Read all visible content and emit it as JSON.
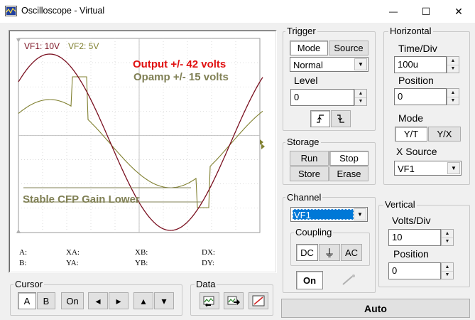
{
  "window": {
    "title": "Oscilloscope - Virtual",
    "minimize_glyph": "—",
    "maximize_glyph": "☐",
    "close_glyph": "✕"
  },
  "display": {
    "ch1_label": "VF1: 10V",
    "ch2_label": "VF2: 5V",
    "ch1_color": "#7a1020",
    "ch2_color": "#808030",
    "annotation_output": "Output +/- 42 volts",
    "annotation_opamp": "Opamp +/- 15 volts",
    "annotation_stable": "Stable CFP Gain Lower",
    "annotation_output_color": "#e01010",
    "annotation_green_color": "#808055",
    "readouts": {
      "a": "A:",
      "xa": "XA:",
      "xb": "XB:",
      "dx": "DX:",
      "b": "B:",
      "ya": "YA:",
      "yb": "YB:",
      "dy": "DY:"
    }
  },
  "trigger": {
    "title": "Trigger",
    "mode_tab": "Mode",
    "source_tab": "Source",
    "mode_value": "Normal",
    "level_label": "Level",
    "level_value": "0"
  },
  "storage": {
    "title": "Storage",
    "run": "Run",
    "stop": "Stop",
    "store": "Store",
    "erase": "Erase"
  },
  "horizontal": {
    "title": "Horizontal",
    "time_div_label": "Time/Div",
    "time_div_value": "100u",
    "position_label": "Position",
    "position_value": "0",
    "mode_label": "Mode",
    "mode_yt": "Y/T",
    "mode_yx": "Y/X",
    "x_source_label": "X Source",
    "x_source_value": "VF1"
  },
  "channel": {
    "title": "Channel",
    "selected": "VF1",
    "coupling_title": "Coupling",
    "dc": "DC",
    "gnd_glyph": "⏚",
    "ac": "AC",
    "on": "On"
  },
  "vertical": {
    "title": "Vertical",
    "volts_div_label": "Volts/Div",
    "volts_div_value": "10",
    "position_label": "Position",
    "position_value": "0"
  },
  "cursor": {
    "title": "Cursor",
    "a": "A",
    "b": "B",
    "on": "On",
    "left_glyph": "◂",
    "right_glyph": "▸",
    "up_glyph": "▴",
    "down_glyph": "▾"
  },
  "data_group": {
    "title": "Data"
  },
  "auto_button": "Auto"
}
